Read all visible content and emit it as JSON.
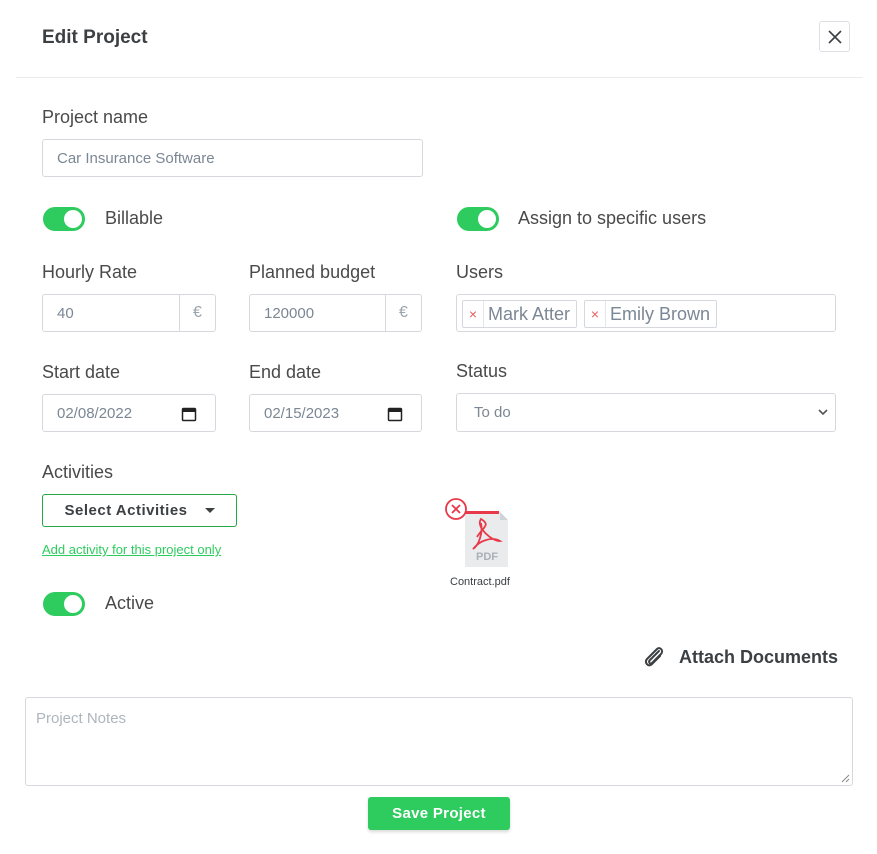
{
  "modal": {
    "title": "Edit Project",
    "close_icon": "close-icon"
  },
  "form": {
    "project_name_label": "Project name",
    "project_name_value": "Car Insurance Software",
    "billable_label": "Billable",
    "billable_on": true,
    "assign_label": "Assign to specific users",
    "assign_on": true,
    "hourly_rate_label": "Hourly Rate",
    "hourly_rate_value": "40",
    "hourly_currency": "€",
    "budget_label": "Planned budget",
    "budget_value": "120000",
    "budget_currency": "€",
    "users_label": "Users",
    "users": [
      "Mark Atter",
      "Emily Brown"
    ],
    "chip_remove": "×",
    "start_label": "Start date",
    "start_value": "02/08/2022",
    "end_label": "End date",
    "end_value": "02/15/2023",
    "status_label": "Status",
    "status_value": "To do",
    "activities_label": "Activities",
    "select_activities": "Select Activities",
    "add_activity_link": "Add activity for this project only",
    "active_label": "Active",
    "active_on": true,
    "attachment_name": "Contract.pdf",
    "pdf_text": "PDF",
    "attach_label": "Attach Documents",
    "notes_placeholder": "Project Notes",
    "save_label": "Save Project"
  },
  "colors": {
    "accent": "#2ecc5f",
    "border": "#d5d9de",
    "danger": "#e85c5c"
  }
}
